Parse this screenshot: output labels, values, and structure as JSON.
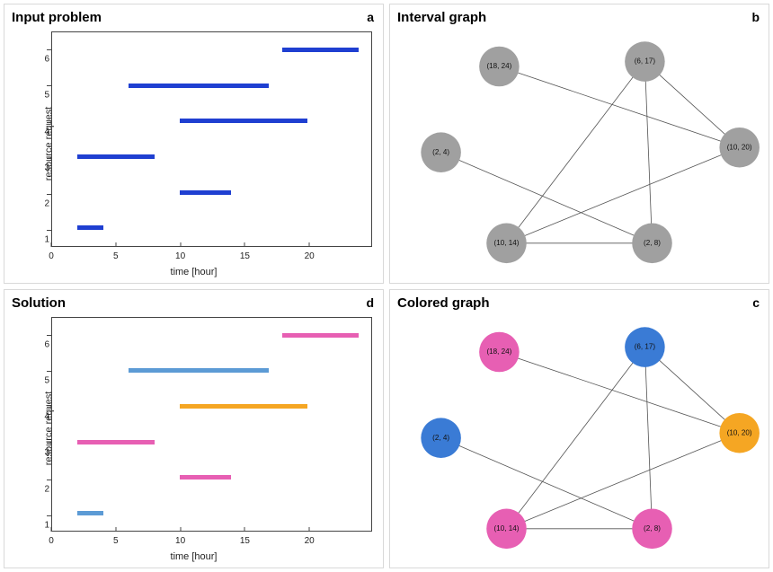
{
  "colors": {
    "blue": "#1f3fd1",
    "lightblue": "#5c9bd5",
    "orange": "#f5a623",
    "pink": "#e75fb3",
    "gray": "#a0a0a0",
    "node_blue": "#3a7bd5",
    "node_orange": "#f5a623",
    "node_pink": "#e75fb3"
  },
  "panels": {
    "a": {
      "title": "Input problem",
      "letter": "a"
    },
    "b": {
      "title": "Interval graph",
      "letter": "b"
    },
    "c": {
      "title": "Colored graph",
      "letter": "c"
    },
    "d": {
      "title": "Solution",
      "letter": "d"
    }
  },
  "axes": {
    "xlabel": "time [hour]",
    "ylabel": "resource request",
    "xticks": [
      0,
      5,
      10,
      15,
      20
    ],
    "yticks": [
      1,
      2,
      3,
      4,
      5,
      6
    ],
    "xmin": 0,
    "xmax": 25,
    "ymin": 0.5,
    "ymax": 6.5
  },
  "chart_data": [
    {
      "panel": "a",
      "type": "interval_chart",
      "title": "Input problem",
      "xlabel": "time [hour]",
      "ylabel": "resource request",
      "xlim": [
        0,
        25
      ],
      "ylim": [
        0.5,
        6.5
      ],
      "intervals": [
        {
          "id": 1,
          "start": 2,
          "end": 4,
          "color_key": "blue"
        },
        {
          "id": 2,
          "start": 10,
          "end": 14,
          "color_key": "blue"
        },
        {
          "id": 3,
          "start": 2,
          "end": 8,
          "color_key": "blue"
        },
        {
          "id": 4,
          "start": 10,
          "end": 20,
          "color_key": "blue"
        },
        {
          "id": 5,
          "start": 6,
          "end": 17,
          "color_key": "blue"
        },
        {
          "id": 6,
          "start": 18,
          "end": 24,
          "color_key": "blue"
        }
      ]
    },
    {
      "panel": "b",
      "type": "graph",
      "title": "Interval graph",
      "nodes": [
        {
          "id": "n1",
          "label": "(18, 24)",
          "x": 0.28,
          "y": 0.15,
          "color_key": "gray"
        },
        {
          "id": "n2",
          "label": "(6, 17)",
          "x": 0.68,
          "y": 0.13,
          "color_key": "gray"
        },
        {
          "id": "n3",
          "label": "(2, 4)",
          "x": 0.12,
          "y": 0.5,
          "color_key": "gray"
        },
        {
          "id": "n4",
          "label": "(10, 20)",
          "x": 0.94,
          "y": 0.48,
          "color_key": "gray"
        },
        {
          "id": "n5",
          "label": "(10, 14)",
          "x": 0.3,
          "y": 0.87,
          "color_key": "gray"
        },
        {
          "id": "n6",
          "label": "(2, 8)",
          "x": 0.7,
          "y": 0.87,
          "color_key": "gray"
        }
      ],
      "edges": [
        [
          "n1",
          "n4"
        ],
        [
          "n2",
          "n4"
        ],
        [
          "n2",
          "n5"
        ],
        [
          "n2",
          "n6"
        ],
        [
          "n3",
          "n6"
        ],
        [
          "n4",
          "n5"
        ],
        [
          "n5",
          "n6"
        ]
      ]
    },
    {
      "panel": "c",
      "type": "graph",
      "title": "Colored graph",
      "nodes": [
        {
          "id": "n1",
          "label": "(18, 24)",
          "x": 0.28,
          "y": 0.15,
          "color_key": "node_pink"
        },
        {
          "id": "n2",
          "label": "(6, 17)",
          "x": 0.68,
          "y": 0.13,
          "color_key": "node_blue"
        },
        {
          "id": "n3",
          "label": "(2, 4)",
          "x": 0.12,
          "y": 0.5,
          "color_key": "node_blue"
        },
        {
          "id": "n4",
          "label": "(10, 20)",
          "x": 0.94,
          "y": 0.48,
          "color_key": "node_orange"
        },
        {
          "id": "n5",
          "label": "(10, 14)",
          "x": 0.3,
          "y": 0.87,
          "color_key": "node_pink"
        },
        {
          "id": "n6",
          "label": "(2, 8)",
          "x": 0.7,
          "y": 0.87,
          "color_key": "node_pink"
        }
      ],
      "edges": [
        [
          "n1",
          "n4"
        ],
        [
          "n2",
          "n4"
        ],
        [
          "n2",
          "n5"
        ],
        [
          "n2",
          "n6"
        ],
        [
          "n3",
          "n6"
        ],
        [
          "n4",
          "n5"
        ],
        [
          "n5",
          "n6"
        ]
      ]
    },
    {
      "panel": "d",
      "type": "interval_chart",
      "title": "Solution",
      "xlabel": "time [hour]",
      "ylabel": "resource request",
      "xlim": [
        0,
        25
      ],
      "ylim": [
        0.5,
        6.5
      ],
      "intervals": [
        {
          "id": 1,
          "start": 2,
          "end": 4,
          "color_key": "lightblue"
        },
        {
          "id": 2,
          "start": 10,
          "end": 14,
          "color_key": "pink"
        },
        {
          "id": 3,
          "start": 2,
          "end": 8,
          "color_key": "pink"
        },
        {
          "id": 4,
          "start": 10,
          "end": 20,
          "color_key": "orange"
        },
        {
          "id": 5,
          "start": 6,
          "end": 17,
          "color_key": "lightblue"
        },
        {
          "id": 6,
          "start": 18,
          "end": 24,
          "color_key": "pink"
        }
      ]
    }
  ]
}
